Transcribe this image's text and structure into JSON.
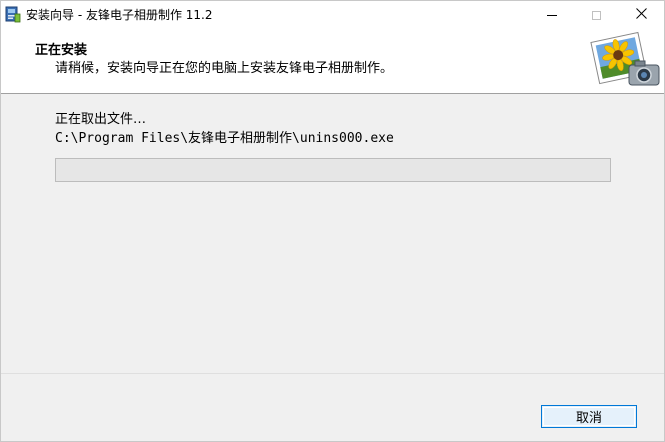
{
  "window": {
    "title": "安装向导 - 友锋电子相册制作 11.2",
    "app_icon": "installer-icon"
  },
  "title_buttons": {
    "minimize_icon": "minimize-icon",
    "maximize_icon": "maximize-icon",
    "close_icon": "close-icon",
    "close_glyph": "✕"
  },
  "header": {
    "title": "正在安装",
    "subtitle": "请稍候，安装向导正在您的电脑上安装友锋电子相册制作。",
    "image_icon": "sunflower-camera-icon"
  },
  "status": {
    "label": "正在取出文件…",
    "path": "C:\\Program Files\\友锋电子相册制作\\unins000.exe",
    "progress": 0
  },
  "footer": {
    "cancel_label": "取消"
  },
  "colors": {
    "accent": "#0078d7",
    "background": "#f0f0f0",
    "header_bg": "#ffffff",
    "progress_fill": "#06b025"
  }
}
